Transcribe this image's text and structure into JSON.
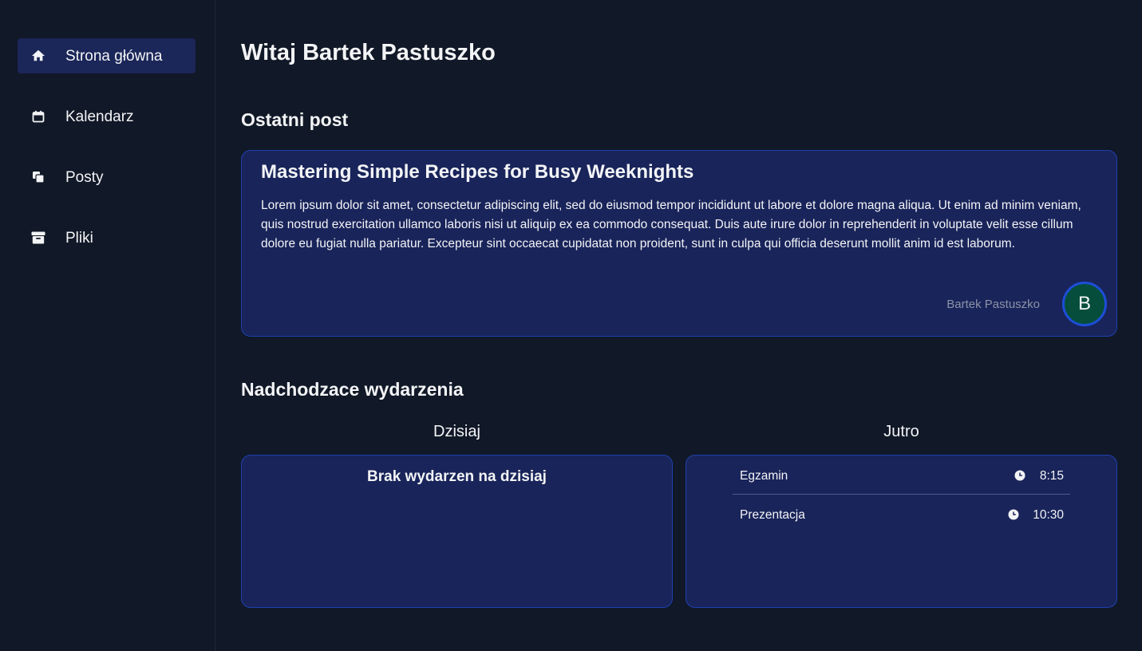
{
  "sidebar": {
    "items": [
      {
        "label": "Strona główna",
        "icon": "home-icon",
        "active": true
      },
      {
        "label": "Kalendarz",
        "icon": "calendar-icon",
        "active": false
      },
      {
        "label": "Posty",
        "icon": "posts-icon",
        "active": false
      },
      {
        "label": "Pliki",
        "icon": "archive-icon",
        "active": false
      }
    ]
  },
  "main": {
    "greeting": "Witaj Bartek Pastuszko",
    "latest_post_title": "Ostatni post",
    "post": {
      "title": "Mastering Simple Recipes for Busy Weeknights",
      "body": "Lorem ipsum dolor sit amet, consectetur adipiscing elit, sed do eiusmod tempor incididunt ut labore et dolore magna aliqua. Ut enim ad minim veniam, quis nostrud exercitation ullamco laboris nisi ut aliquip ex ea commodo consequat. Duis aute irure dolor in reprehenderit in voluptate velit esse cillum dolore eu fugiat nulla pariatur. Excepteur sint occaecat cupidatat non proident, sunt in culpa qui officia deserunt mollit anim id est laborum.",
      "author": "Bartek Pastuszko",
      "avatar_letter": "B"
    },
    "upcoming_title": "Nadchodzace wydarzenia",
    "today": {
      "heading": "Dzisiaj",
      "empty_message": "Brak wydarzen na dzisiaj"
    },
    "tomorrow": {
      "heading": "Jutro",
      "events": [
        {
          "name": "Egzamin",
          "time": "8:15"
        },
        {
          "name": "Prezentacja",
          "time": "10:30"
        }
      ]
    }
  },
  "colors": {
    "background": "#111827",
    "card": "#19245a",
    "card_border": "#1e40af",
    "active_nav": "#1b2659",
    "avatar": "#064e3b",
    "avatar_ring": "#1d4ed8"
  }
}
